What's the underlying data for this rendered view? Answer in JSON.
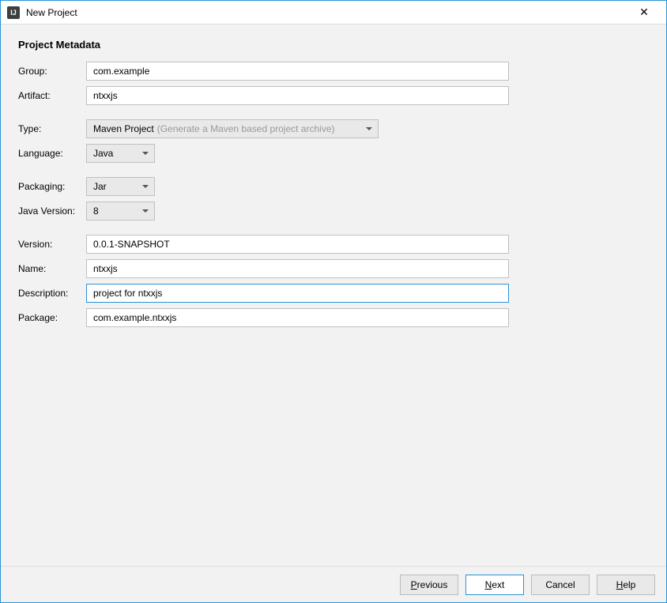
{
  "titlebar": {
    "title": "New Project",
    "icon_label": "IJ"
  },
  "heading": "Project Metadata",
  "fields": {
    "group_label": "Group:",
    "group_value": "com.example",
    "artifact_label": "Artifact:",
    "artifact_value": "ntxxjs",
    "type_label": "Type:",
    "type_value": "Maven Project",
    "type_hint": "(Generate a Maven based project archive)",
    "language_label": "Language:",
    "language_value": "Java",
    "packaging_label": "Packaging:",
    "packaging_value": "Jar",
    "javaversion_label": "Java Version:",
    "javaversion_value": "8",
    "version_label": "Version:",
    "version_value": "0.0.1-SNAPSHOT",
    "name_label": "Name:",
    "name_value": "ntxxjs",
    "description_label": "Description:",
    "description_value": "project for ntxxjs",
    "package_label": "Package:",
    "package_value": "com.example.ntxxjs"
  },
  "buttons": {
    "previous_p": "P",
    "previous_rest": "revious",
    "next_n": "N",
    "next_rest": "ext",
    "cancel": "Cancel",
    "help_h": "H",
    "help_rest": "elp"
  }
}
